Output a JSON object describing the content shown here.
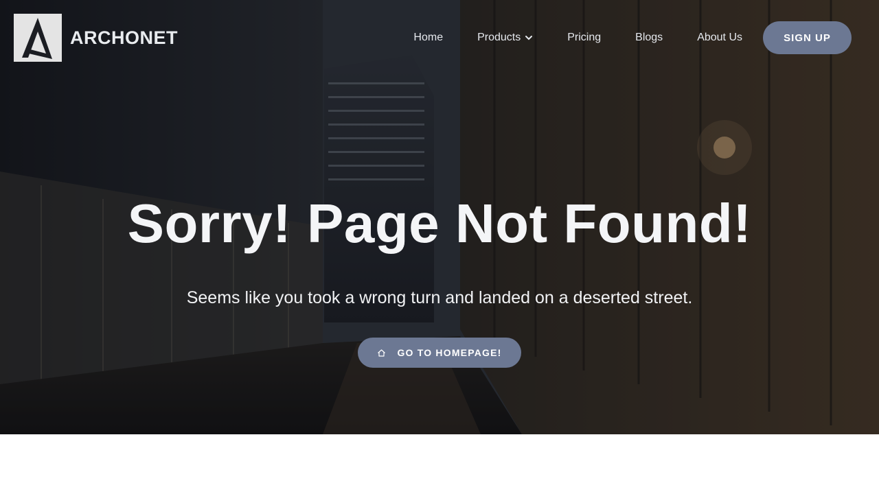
{
  "brand": {
    "name": "ARCHONET",
    "logo_icon": "archonet-logo-icon"
  },
  "nav": {
    "items": [
      {
        "label": "Home"
      },
      {
        "label": "Products",
        "icon": "chevron-down-icon"
      },
      {
        "label": "Pricing"
      },
      {
        "label": "Blogs"
      },
      {
        "label": "About Us"
      }
    ],
    "signup_label": "SIGN UP"
  },
  "hero": {
    "title": "Sorry! Page Not Found!",
    "subtitle": "Seems like you took a wrong turn and landed on a deserted street.",
    "button_label": "GO TO HOMEPAGE!",
    "button_icon": "home-icon"
  },
  "colors": {
    "accent": "#6c7893",
    "text_light": "#f4f5f7",
    "page_bg": "#ffffff"
  }
}
